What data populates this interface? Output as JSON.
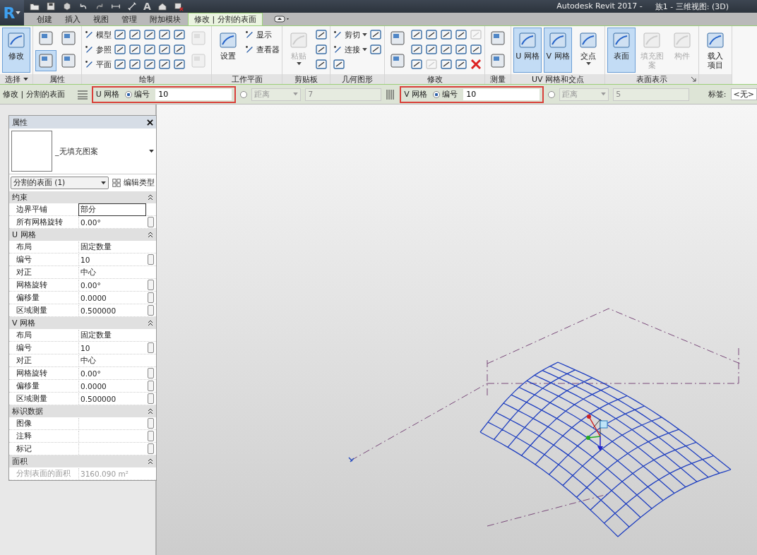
{
  "app_menu": {
    "letter": "R"
  },
  "quick_access": {
    "text_tool": "A"
  },
  "window": {
    "app": "Autodesk Revit 2017 -",
    "document": "族1 - 三维视图: (3D)"
  },
  "tabs": [
    {
      "label": "创建",
      "selected": false
    },
    {
      "label": "插入",
      "selected": false
    },
    {
      "label": "视图",
      "selected": false
    },
    {
      "label": "管理",
      "selected": false
    },
    {
      "label": "附加模块",
      "selected": false
    },
    {
      "label": "修改 | 分割的表面",
      "selected": true
    }
  ],
  "ribbon": {
    "panels": [
      {
        "label": "选择",
        "menu": true,
        "tools": [
          {
            "kind": "large",
            "label": "修改",
            "selected": true
          }
        ]
      },
      {
        "label": "属性",
        "tools": [
          {
            "kind": "tile"
          },
          {
            "kind": "tile",
            "selected": true
          },
          {
            "kind": "tile"
          },
          {
            "kind": "tile"
          }
        ]
      },
      {
        "label": "绘制",
        "tools": [
          {
            "kind": "small",
            "label": "模型"
          },
          {
            "kind": "small",
            "label": "参照"
          },
          {
            "kind": "small",
            "label": "平面"
          },
          {
            "kind": "icon"
          },
          {
            "kind": "icon"
          },
          {
            "kind": "icon"
          },
          {
            "kind": "icon"
          },
          {
            "kind": "icon"
          },
          {
            "kind": "icon"
          },
          {
            "kind": "icon"
          },
          {
            "kind": "icon"
          },
          {
            "kind": "icon"
          },
          {
            "kind": "icon"
          },
          {
            "kind": "icon"
          },
          {
            "kind": "icon"
          },
          {
            "kind": "icon"
          },
          {
            "kind": "icon"
          },
          {
            "kind": "icon"
          },
          {
            "kind": "tile",
            "disabled": true
          },
          {
            "kind": "tile",
            "disabled": true
          }
        ]
      },
      {
        "label": "工作平面",
        "tools": [
          {
            "kind": "large",
            "label": "设置"
          },
          {
            "kind": "small",
            "label": "显示"
          },
          {
            "kind": "small",
            "label": "查看器"
          }
        ]
      },
      {
        "label": "剪贴板",
        "tools": [
          {
            "kind": "large",
            "label": "粘贴",
            "disabled": true,
            "menu": true
          },
          {
            "kind": "icon"
          },
          {
            "kind": "icon"
          },
          {
            "kind": "icon"
          }
        ]
      },
      {
        "label": "几何图形",
        "tools": [
          {
            "kind": "small",
            "label": "剪切",
            "menu": true
          },
          {
            "kind": "small",
            "label": "连接",
            "menu": true
          },
          {
            "kind": "icon"
          },
          {
            "kind": "icon"
          },
          {
            "kind": "icon"
          }
        ]
      },
      {
        "label": "修改",
        "tools": [
          {
            "kind": "tile"
          },
          {
            "kind": "tile"
          },
          {
            "kind": "icon"
          },
          {
            "kind": "icon"
          },
          {
            "kind": "icon"
          },
          {
            "kind": "icon"
          },
          {
            "kind": "icon"
          },
          {
            "kind": "icon",
            "disabled": true
          },
          {
            "kind": "icon"
          },
          {
            "kind": "icon"
          },
          {
            "kind": "icon"
          },
          {
            "kind": "icon"
          },
          {
            "kind": "icon"
          },
          {
            "kind": "icon"
          },
          {
            "kind": "icon",
            "disabled": true
          },
          {
            "kind": "icon"
          },
          {
            "kind": "delete"
          }
        ]
      },
      {
        "label": "测量",
        "tools": [
          {
            "kind": "tile"
          },
          {
            "kind": "tile"
          }
        ]
      },
      {
        "label": "UV 网格和交点",
        "tools": [
          {
            "kind": "large",
            "label": "U 网格",
            "selected": true
          },
          {
            "kind": "large",
            "label": "V 网格",
            "selected": true
          },
          {
            "kind": "large",
            "label": "交点",
            "menu": true
          }
        ]
      },
      {
        "label": "表面表示",
        "launcher": true,
        "tools": [
          {
            "kind": "large",
            "label": "表面",
            "selected": true
          },
          {
            "kind": "large",
            "label": "填充图案",
            "disabled": true
          },
          {
            "kind": "large",
            "label": "构件",
            "disabled": true
          }
        ]
      },
      {
        "tools": [
          {
            "kind": "large",
            "label_lines": [
              "载入",
              "项目"
            ]
          }
        ]
      }
    ]
  },
  "options_bar": {
    "context": "修改 | 分割的表面",
    "grids": [
      {
        "label": "U 网格",
        "highlighted": true,
        "number_option": {
          "label": "编号",
          "selected": true
        },
        "number_value": "10",
        "distance_option": {
          "label": "距离",
          "selected": false
        },
        "distance_value": "7"
      },
      {
        "label": "V 网格",
        "highlighted": true,
        "number_option": {
          "label": "编号",
          "selected": true
        },
        "number_value": "10",
        "distance_option": {
          "label": "距离",
          "selected": false
        },
        "distance_value": "5"
      }
    ],
    "tag_label": "标签:",
    "tag_value": "<无>"
  },
  "properties": {
    "title": "属性",
    "type_name": "_无填充图案",
    "selector": "分割的表面 (1)",
    "edit_type": "编辑类型",
    "groups": [
      {
        "name": "约束",
        "expanded": true,
        "rows": [
          {
            "name": "边界平铺",
            "value": "部分",
            "editing": true
          },
          {
            "name": "所有网格旋转",
            "value": "0.00°",
            "button": true
          }
        ]
      },
      {
        "name": "U 网格",
        "expanded": true,
        "rows": [
          {
            "name": "布局",
            "value": "固定数量"
          },
          {
            "name": "编号",
            "value": "10",
            "button": true
          },
          {
            "name": "对正",
            "value": "中心"
          },
          {
            "name": "网格旋转",
            "value": "0.00°",
            "button": true
          },
          {
            "name": "偏移量",
            "value": "0.0000",
            "button": true
          },
          {
            "name": "区域测量",
            "value": "0.500000",
            "button": true
          }
        ]
      },
      {
        "name": "V 网格",
        "expanded": true,
        "rows": [
          {
            "name": "布局",
            "value": "固定数量"
          },
          {
            "name": "编号",
            "value": "10",
            "button": true
          },
          {
            "name": "对正",
            "value": "中心"
          },
          {
            "name": "网格旋转",
            "value": "0.00°",
            "button": true
          },
          {
            "name": "偏移量",
            "value": "0.0000",
            "button": true
          },
          {
            "name": "区域测量",
            "value": "0.500000",
            "button": true
          }
        ]
      },
      {
        "name": "标识数据",
        "expanded": true,
        "rows": [
          {
            "name": "图像",
            "button": true
          },
          {
            "name": "注释",
            "button": true
          },
          {
            "name": "标记",
            "button": true
          }
        ]
      },
      {
        "name": "面积",
        "expanded": true,
        "rows": [
          {
            "name": "分割表面的面积",
            "value": "3160.090 m²",
            "disabled": true
          }
        ]
      }
    ]
  }
}
